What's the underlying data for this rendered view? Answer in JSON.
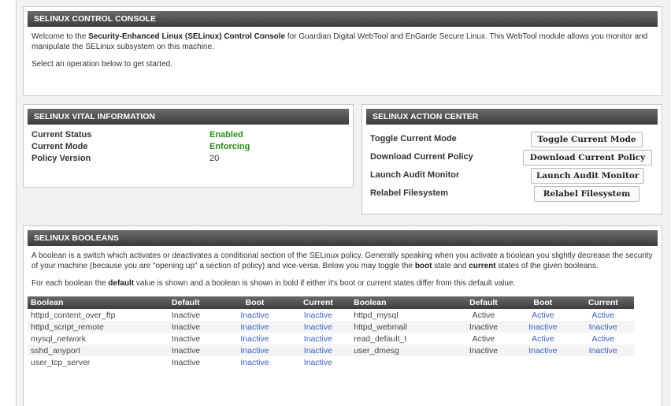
{
  "console": {
    "title": "SELINUX CONTROL CONSOLE",
    "intro_pre": "Welcome to the ",
    "intro_bold": "Security-Enhanced Linux (SELinux) Control Console",
    "intro_post": " for Guardian Digital WebTool and EnGarde Secure Linux. This WebTool module allows you monitor and manipulate the SELinux subsystem on this machine.",
    "select_text": "Select an operation below to get started."
  },
  "vital": {
    "title": "SELINUX VITAL INFORMATION",
    "rows": [
      {
        "label": "Current Status",
        "value": "Enabled"
      },
      {
        "label": "Current Mode",
        "value": "Enforcing"
      },
      {
        "label": "Policy Version",
        "value": "20"
      }
    ]
  },
  "action": {
    "title": "SELINUX ACTION CENTER",
    "rows": [
      {
        "label": "Toggle Current Mode",
        "button": "Toggle Current Mode"
      },
      {
        "label": "Download Current Policy",
        "button": "Download Current Policy"
      },
      {
        "label": "Launch Audit Monitor",
        "button": "Launch Audit Monitor"
      },
      {
        "label": "Relabel Filesystem",
        "button": "Relabel Filesystem"
      }
    ]
  },
  "booleans": {
    "title": "SELINUX BOOLEANS",
    "desc_pre": "A boolean is a switch which activates or deactivates a conditional section of the SELinux policy. Generally speaking when you activate a boolean you slightly decrease the security of your machine (because you are \"opening up\" a section of policy) and vice-versa. Below you may toggle the ",
    "desc_boot": "boot",
    "desc_mid": " state and ",
    "desc_current": "current",
    "desc_post": " states of the given booleans.",
    "note_pre": "For each boolean the ",
    "note_bold": "default",
    "note_post": " value is shown and a boolean is shown in bold if either it's boot or current states differ from this default value.",
    "headers": [
      "Boolean",
      "Default",
      "Boot",
      "Current",
      "Boolean",
      "Default",
      "Boot",
      "Current"
    ],
    "rows": [
      [
        "httpd_content_over_ftp",
        "Inactive",
        "Inactive",
        "Inactive",
        "httpd_mysql",
        "Active",
        "Active",
        "Active"
      ],
      [
        "httpd_script_remote",
        "Inactive",
        "Inactive",
        "Inactive",
        "httpd_webmail",
        "Inactive",
        "Inactive",
        "Inactive"
      ],
      [
        "mysql_network",
        "Inactive",
        "Inactive",
        "Inactive",
        "read_default_t",
        "Active",
        "Active",
        "Active"
      ],
      [
        "sshd_anyport",
        "Inactive",
        "Inactive",
        "Inactive",
        "user_dmesg",
        "Inactive",
        "Inactive",
        "Inactive"
      ],
      [
        "user_tcp_server",
        "Inactive",
        "Inactive",
        "Inactive",
        "",
        "",
        "",
        ""
      ]
    ]
  }
}
